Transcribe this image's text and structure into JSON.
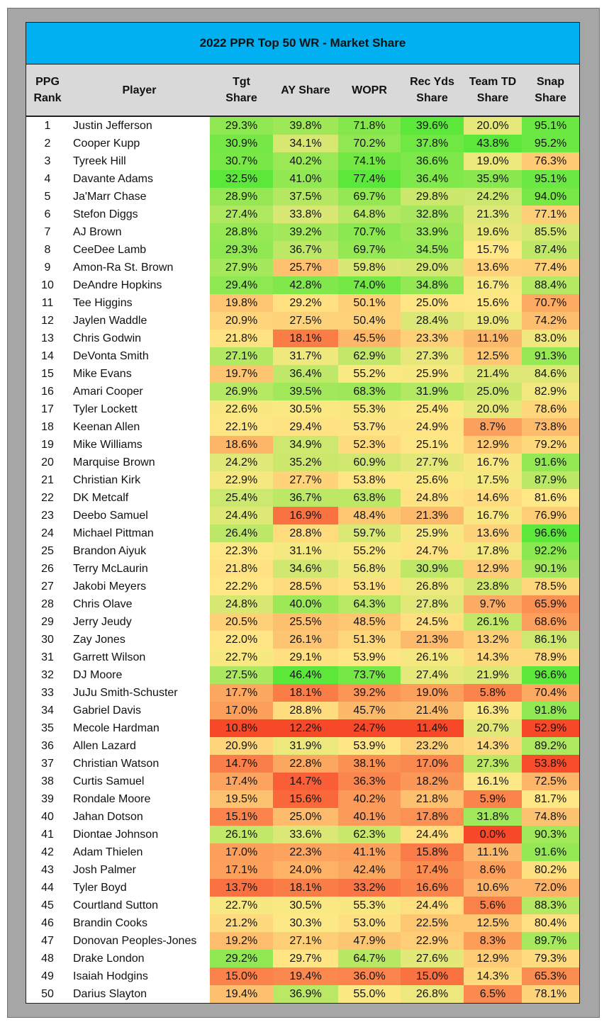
{
  "title": "2022 PPR Top 50 WR - Market Share",
  "columns": [
    {
      "key": "rank",
      "label_line1": "PPG",
      "label_line2": "Rank"
    },
    {
      "key": "player",
      "label_line1": "Player",
      "label_line2": ""
    },
    {
      "key": "tgt",
      "label_line1": "Tgt",
      "label_line2": "Share"
    },
    {
      "key": "ay",
      "label_line1": "AY Share",
      "label_line2": ""
    },
    {
      "key": "wopr",
      "label_line1": "WOPR",
      "label_line2": ""
    },
    {
      "key": "rec",
      "label_line1": "Rec Yds",
      "label_line2": "Share"
    },
    {
      "key": "td",
      "label_line1": "Team TD",
      "label_line2": "Share"
    },
    {
      "key": "snap",
      "label_line1": "Snap",
      "label_line2": "Share"
    }
  ],
  "color_scale": {
    "low": "#f8482a",
    "mid": "#ffe885",
    "high": "#5ce83a"
  },
  "rows": [
    {
      "rank": "1",
      "player": "Justin Jefferson",
      "tgt": "29.3%",
      "ay": "39.8%",
      "wopr": "71.8%",
      "rec": "39.6%",
      "td": "20.0%",
      "snap": "95.1%"
    },
    {
      "rank": "2",
      "player": "Cooper Kupp",
      "tgt": "30.9%",
      "ay": "34.1%",
      "wopr": "70.2%",
      "rec": "37.8%",
      "td": "43.8%",
      "snap": "95.2%"
    },
    {
      "rank": "3",
      "player": "Tyreek Hill",
      "tgt": "30.7%",
      "ay": "40.2%",
      "wopr": "74.1%",
      "rec": "36.6%",
      "td": "19.0%",
      "snap": "76.3%"
    },
    {
      "rank": "4",
      "player": "Davante Adams",
      "tgt": "32.5%",
      "ay": "41.0%",
      "wopr": "77.4%",
      "rec": "36.4%",
      "td": "35.9%",
      "snap": "95.1%"
    },
    {
      "rank": "5",
      "player": "Ja'Marr Chase",
      "tgt": "28.9%",
      "ay": "37.5%",
      "wopr": "69.7%",
      "rec": "29.8%",
      "td": "24.2%",
      "snap": "94.0%"
    },
    {
      "rank": "6",
      "player": "Stefon Diggs",
      "tgt": "27.4%",
      "ay": "33.8%",
      "wopr": "64.8%",
      "rec": "32.8%",
      "td": "21.3%",
      "snap": "77.1%"
    },
    {
      "rank": "7",
      "player": "AJ Brown",
      "tgt": "28.8%",
      "ay": "39.2%",
      "wopr": "70.7%",
      "rec": "33.9%",
      "td": "19.6%",
      "snap": "85.5%"
    },
    {
      "rank": "8",
      "player": "CeeDee Lamb",
      "tgt": "29.3%",
      "ay": "36.7%",
      "wopr": "69.7%",
      "rec": "34.5%",
      "td": "15.7%",
      "snap": "87.4%"
    },
    {
      "rank": "9",
      "player": "Amon-Ra St. Brown",
      "tgt": "27.9%",
      "ay": "25.7%",
      "wopr": "59.8%",
      "rec": "29.0%",
      "td": "13.6%",
      "snap": "77.4%"
    },
    {
      "rank": "10",
      "player": "DeAndre Hopkins",
      "tgt": "29.4%",
      "ay": "42.8%",
      "wopr": "74.0%",
      "rec": "34.8%",
      "td": "16.7%",
      "snap": "88.4%"
    },
    {
      "rank": "11",
      "player": "Tee Higgins",
      "tgt": "19.8%",
      "ay": "29.2%",
      "wopr": "50.1%",
      "rec": "25.0%",
      "td": "15.6%",
      "snap": "70.7%"
    },
    {
      "rank": "12",
      "player": "Jaylen Waddle",
      "tgt": "20.9%",
      "ay": "27.5%",
      "wopr": "50.4%",
      "rec": "28.4%",
      "td": "19.0%",
      "snap": "74.2%"
    },
    {
      "rank": "13",
      "player": "Chris Godwin",
      "tgt": "21.8%",
      "ay": "18.1%",
      "wopr": "45.5%",
      "rec": "23.3%",
      "td": "11.1%",
      "snap": "83.0%"
    },
    {
      "rank": "14",
      "player": "DeVonta Smith",
      "tgt": "27.1%",
      "ay": "31.7%",
      "wopr": "62.9%",
      "rec": "27.3%",
      "td": "12.5%",
      "snap": "91.3%"
    },
    {
      "rank": "15",
      "player": "Mike Evans",
      "tgt": "19.7%",
      "ay": "36.4%",
      "wopr": "55.2%",
      "rec": "25.9%",
      "td": "21.4%",
      "snap": "84.6%"
    },
    {
      "rank": "16",
      "player": "Amari Cooper",
      "tgt": "26.9%",
      "ay": "39.5%",
      "wopr": "68.3%",
      "rec": "31.9%",
      "td": "25.0%",
      "snap": "82.9%"
    },
    {
      "rank": "17",
      "player": "Tyler Lockett",
      "tgt": "22.6%",
      "ay": "30.5%",
      "wopr": "55.3%",
      "rec": "25.4%",
      "td": "20.0%",
      "snap": "78.6%"
    },
    {
      "rank": "18",
      "player": "Keenan Allen",
      "tgt": "22.1%",
      "ay": "29.4%",
      "wopr": "53.7%",
      "rec": "24.9%",
      "td": "8.7%",
      "snap": "73.8%"
    },
    {
      "rank": "19",
      "player": "Mike Williams",
      "tgt": "18.6%",
      "ay": "34.9%",
      "wopr": "52.3%",
      "rec": "25.1%",
      "td": "12.9%",
      "snap": "79.2%"
    },
    {
      "rank": "20",
      "player": "Marquise Brown",
      "tgt": "24.2%",
      "ay": "35.2%",
      "wopr": "60.9%",
      "rec": "27.7%",
      "td": "16.7%",
      "snap": "91.6%"
    },
    {
      "rank": "21",
      "player": "Christian Kirk",
      "tgt": "22.9%",
      "ay": "27.7%",
      "wopr": "53.8%",
      "rec": "25.6%",
      "td": "17.5%",
      "snap": "87.9%"
    },
    {
      "rank": "22",
      "player": "DK Metcalf",
      "tgt": "25.4%",
      "ay": "36.7%",
      "wopr": "63.8%",
      "rec": "24.8%",
      "td": "14.6%",
      "snap": "81.6%"
    },
    {
      "rank": "23",
      "player": "Deebo Samuel",
      "tgt": "24.4%",
      "ay": "16.9%",
      "wopr": "48.4%",
      "rec": "21.3%",
      "td": "16.7%",
      "snap": "76.9%"
    },
    {
      "rank": "24",
      "player": "Michael Pittman",
      "tgt": "26.4%",
      "ay": "28.8%",
      "wopr": "59.7%",
      "rec": "25.9%",
      "td": "13.6%",
      "snap": "96.6%"
    },
    {
      "rank": "25",
      "player": "Brandon Aiyuk",
      "tgt": "22.3%",
      "ay": "31.1%",
      "wopr": "55.2%",
      "rec": "24.7%",
      "td": "17.8%",
      "snap": "92.2%"
    },
    {
      "rank": "26",
      "player": "Terry McLaurin",
      "tgt": "21.8%",
      "ay": "34.6%",
      "wopr": "56.8%",
      "rec": "30.9%",
      "td": "12.9%",
      "snap": "90.1%"
    },
    {
      "rank": "27",
      "player": "Jakobi Meyers",
      "tgt": "22.2%",
      "ay": "28.5%",
      "wopr": "53.1%",
      "rec": "26.8%",
      "td": "23.8%",
      "snap": "78.5%"
    },
    {
      "rank": "28",
      "player": "Chris Olave",
      "tgt": "24.8%",
      "ay": "40.0%",
      "wopr": "64.3%",
      "rec": "27.8%",
      "td": "9.7%",
      "snap": "65.9%"
    },
    {
      "rank": "29",
      "player": "Jerry Jeudy",
      "tgt": "20.5%",
      "ay": "25.5%",
      "wopr": "48.5%",
      "rec": "24.5%",
      "td": "26.1%",
      "snap": "68.6%"
    },
    {
      "rank": "30",
      "player": "Zay Jones",
      "tgt": "22.0%",
      "ay": "26.1%",
      "wopr": "51.3%",
      "rec": "21.3%",
      "td": "13.2%",
      "snap": "86.1%"
    },
    {
      "rank": "31",
      "player": "Garrett Wilson",
      "tgt": "22.7%",
      "ay": "29.1%",
      "wopr": "53.9%",
      "rec": "26.1%",
      "td": "14.3%",
      "snap": "78.9%"
    },
    {
      "rank": "32",
      "player": "DJ Moore",
      "tgt": "27.5%",
      "ay": "46.4%",
      "wopr": "73.7%",
      "rec": "27.4%",
      "td": "21.9%",
      "snap": "96.6%"
    },
    {
      "rank": "33",
      "player": "JuJu Smith-Schuster",
      "tgt": "17.7%",
      "ay": "18.1%",
      "wopr": "39.2%",
      "rec": "19.0%",
      "td": "5.8%",
      "snap": "70.4%"
    },
    {
      "rank": "34",
      "player": "Gabriel Davis",
      "tgt": "17.0%",
      "ay": "28.8%",
      "wopr": "45.7%",
      "rec": "21.4%",
      "td": "16.3%",
      "snap": "91.8%"
    },
    {
      "rank": "35",
      "player": "Mecole Hardman",
      "tgt": "10.8%",
      "ay": "12.2%",
      "wopr": "24.7%",
      "rec": "11.4%",
      "td": "20.7%",
      "snap": "52.9%"
    },
    {
      "rank": "36",
      "player": "Allen Lazard",
      "tgt": "20.9%",
      "ay": "31.9%",
      "wopr": "53.9%",
      "rec": "23.2%",
      "td": "14.3%",
      "snap": "89.2%"
    },
    {
      "rank": "37",
      "player": "Christian Watson",
      "tgt": "14.7%",
      "ay": "22.8%",
      "wopr": "38.1%",
      "rec": "17.0%",
      "td": "27.3%",
      "snap": "53.8%"
    },
    {
      "rank": "38",
      "player": "Curtis Samuel",
      "tgt": "17.4%",
      "ay": "14.7%",
      "wopr": "36.3%",
      "rec": "18.2%",
      "td": "16.1%",
      "snap": "72.5%"
    },
    {
      "rank": "39",
      "player": "Rondale Moore",
      "tgt": "19.5%",
      "ay": "15.6%",
      "wopr": "40.2%",
      "rec": "21.8%",
      "td": "5.9%",
      "snap": "81.7%"
    },
    {
      "rank": "40",
      "player": "Jahan Dotson",
      "tgt": "15.1%",
      "ay": "25.0%",
      "wopr": "40.1%",
      "rec": "17.8%",
      "td": "31.8%",
      "snap": "74.8%"
    },
    {
      "rank": "41",
      "player": "Diontae Johnson",
      "tgt": "26.1%",
      "ay": "33.6%",
      "wopr": "62.3%",
      "rec": "24.4%",
      "td": "0.0%",
      "snap": "90.3%"
    },
    {
      "rank": "42",
      "player": "Adam Thielen",
      "tgt": "17.0%",
      "ay": "22.3%",
      "wopr": "41.1%",
      "rec": "15.8%",
      "td": "11.1%",
      "snap": "91.6%"
    },
    {
      "rank": "43",
      "player": "Josh Palmer",
      "tgt": "17.1%",
      "ay": "24.0%",
      "wopr": "42.4%",
      "rec": "17.4%",
      "td": "8.6%",
      "snap": "80.2%"
    },
    {
      "rank": "44",
      "player": "Tyler Boyd",
      "tgt": "13.7%",
      "ay": "18.1%",
      "wopr": "33.2%",
      "rec": "16.6%",
      "td": "10.6%",
      "snap": "72.0%"
    },
    {
      "rank": "45",
      "player": "Courtland Sutton",
      "tgt": "22.7%",
      "ay": "30.5%",
      "wopr": "55.3%",
      "rec": "24.4%",
      "td": "5.6%",
      "snap": "88.3%"
    },
    {
      "rank": "46",
      "player": "Brandin Cooks",
      "tgt": "21.2%",
      "ay": "30.3%",
      "wopr": "53.0%",
      "rec": "22.5%",
      "td": "12.5%",
      "snap": "80.4%"
    },
    {
      "rank": "47",
      "player": "Donovan Peoples-Jones",
      "tgt": "19.2%",
      "ay": "27.1%",
      "wopr": "47.9%",
      "rec": "22.9%",
      "td": "8.3%",
      "snap": "89.7%"
    },
    {
      "rank": "48",
      "player": "Drake London",
      "tgt": "29.2%",
      "ay": "29.7%",
      "wopr": "64.7%",
      "rec": "27.6%",
      "td": "12.9%",
      "snap": "79.3%"
    },
    {
      "rank": "49",
      "player": "Isaiah Hodgins",
      "tgt": "15.0%",
      "ay": "19.4%",
      "wopr": "36.0%",
      "rec": "15.0%",
      "td": "14.3%",
      "snap": "65.3%"
    },
    {
      "rank": "50",
      "player": "Darius Slayton",
      "tgt": "19.4%",
      "ay": "36.9%",
      "wopr": "55.0%",
      "rec": "26.8%",
      "td": "6.5%",
      "snap": "78.1%"
    }
  ]
}
